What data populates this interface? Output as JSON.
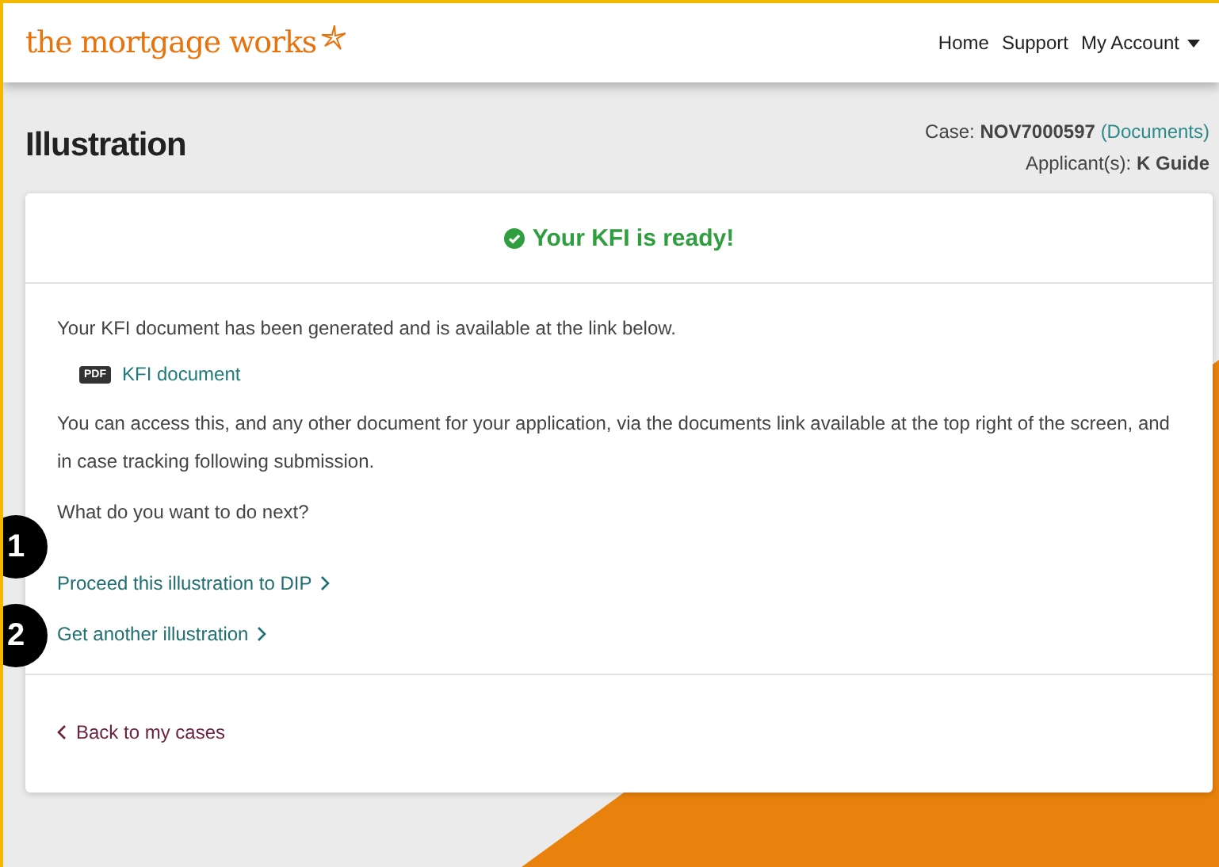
{
  "header": {
    "logo": "the mortgage works",
    "nav": [
      {
        "label": "Home",
        "kind": "link"
      },
      {
        "label": "Support",
        "kind": "link"
      },
      {
        "label": "My Account",
        "kind": "dropdown"
      }
    ]
  },
  "page": {
    "title": "Illustration",
    "case_label": "Case:",
    "case_number": "NOV7000597",
    "documents_link": "(Documents)",
    "applicant_label": "Applicant(s):",
    "applicant_name": "K Guide"
  },
  "card": {
    "status": "Your KFI is ready!",
    "intro": "Your KFI document has been generated and is available at the link below.",
    "document": {
      "badge": "PDF",
      "label": "KFI document"
    },
    "info": "You can access this, and any other document for your application, via the documents link available at the top right of the screen, and in case tracking following submission.",
    "question": "What do you want to do next?",
    "actions": [
      {
        "label": "Proceed this illustration to DIP",
        "callout": "1"
      },
      {
        "label": "Get another illustration",
        "callout": "2"
      }
    ],
    "back_link": "Back to my cases"
  }
}
